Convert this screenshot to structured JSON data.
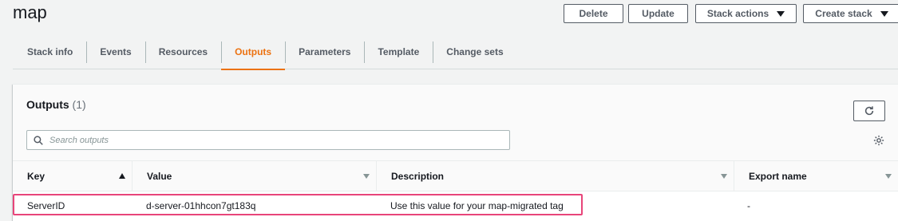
{
  "header": {
    "title": "map",
    "actions": {
      "delete": "Delete",
      "update": "Update",
      "stack_actions": "Stack actions",
      "create_stack": "Create stack"
    }
  },
  "tabs": [
    {
      "label": "Stack info"
    },
    {
      "label": "Events"
    },
    {
      "label": "Resources"
    },
    {
      "label": "Outputs",
      "active": true
    },
    {
      "label": "Parameters"
    },
    {
      "label": "Template"
    },
    {
      "label": "Change sets"
    }
  ],
  "outputs_panel": {
    "title": "Outputs",
    "count": "(1)",
    "search": {
      "placeholder": "Search outputs",
      "value": ""
    },
    "columns": {
      "key": "Key",
      "value": "Value",
      "description": "Description",
      "export_name": "Export name"
    },
    "rows": [
      {
        "key": "ServerID",
        "value": "d-server-01hhcon7gt183q",
        "description": "Use this value for your map-migrated tag",
        "export_name": "-"
      }
    ]
  },
  "colors": {
    "accent": "#ec7211",
    "highlight": "#e8457a",
    "border": "#545b64"
  }
}
